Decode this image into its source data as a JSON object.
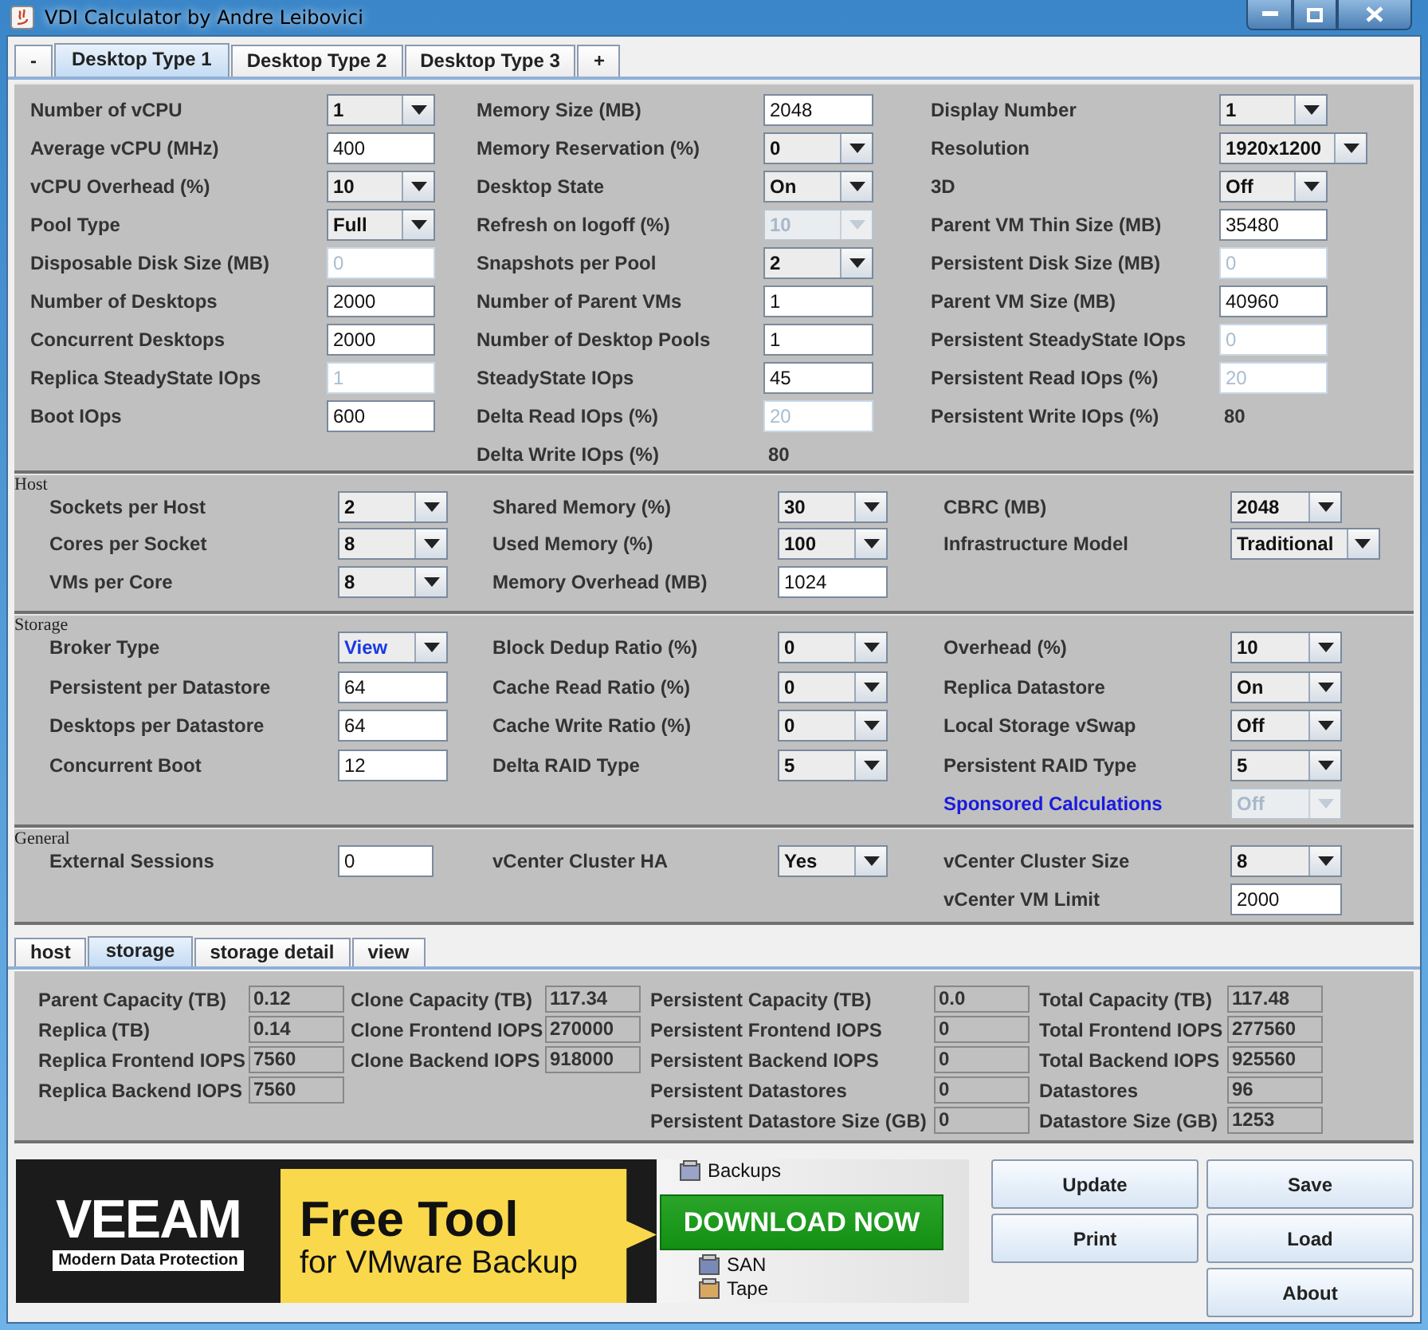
{
  "window": {
    "title": "VDI Calculator by Andre Leibovici"
  },
  "desktop_tabs": [
    {
      "label": "-",
      "selected": false
    },
    {
      "label": "Desktop Type 1",
      "selected": true
    },
    {
      "label": "Desktop Type 2",
      "selected": false
    },
    {
      "label": "Desktop Type 3",
      "selected": false
    },
    {
      "label": "+",
      "selected": false
    }
  ],
  "sections": [
    {
      "columns": [
        [
          {
            "label": "Number of vCPU",
            "kind": "combo",
            "value": "1",
            "disabled": false
          },
          {
            "label": "Average vCPU (MHz)",
            "kind": "text",
            "value": "400",
            "disabled": false
          },
          {
            "label": "vCPU Overhead (%)",
            "kind": "combo",
            "value": "10",
            "disabled": false
          },
          {
            "label": "Pool Type",
            "kind": "combo",
            "value": "Full",
            "disabled": false
          },
          {
            "label": "Disposable Disk Size (MB)",
            "kind": "text",
            "value": "0",
            "disabled": true
          },
          {
            "label": "Number of Desktops",
            "kind": "text",
            "value": "2000",
            "disabled": false
          },
          {
            "label": "Concurrent Desktops",
            "kind": "text",
            "value": "2000",
            "disabled": false
          },
          {
            "label": "Replica SteadyState IOps",
            "kind": "text",
            "value": "1",
            "disabled": true
          },
          {
            "label": "Boot IOps",
            "kind": "text",
            "value": "600",
            "disabled": false
          }
        ],
        [
          {
            "label": "Memory Size (MB)",
            "kind": "text",
            "value": "2048",
            "disabled": false
          },
          {
            "label": "Memory Reservation (%)",
            "kind": "combo",
            "value": "0",
            "disabled": false
          },
          {
            "label": "Desktop State",
            "kind": "combo",
            "value": "On",
            "disabled": false
          },
          {
            "label": "Refresh on logoff (%)",
            "kind": "combo",
            "value": "10",
            "disabled": true
          },
          {
            "label": "Snapshots per Pool",
            "kind": "combo",
            "value": "2",
            "disabled": false
          },
          {
            "label": "Number of Parent VMs",
            "kind": "text",
            "value": "1",
            "disabled": false
          },
          {
            "label": "Number of Desktop Pools",
            "kind": "text",
            "value": "1",
            "disabled": false
          },
          {
            "label": "SteadyState IOps",
            "kind": "text",
            "value": "45",
            "disabled": false
          },
          {
            "label": "Delta Read IOps (%)",
            "kind": "text",
            "value": "20",
            "disabled": true
          },
          {
            "label": "Delta Write IOps (%)",
            "kind": "value",
            "value": "80"
          }
        ],
        [
          {
            "label": "Display Number",
            "kind": "combo",
            "value": "1",
            "disabled": false
          },
          {
            "label": "Resolution",
            "kind": "combo",
            "value": "1920x1200",
            "disabled": false
          },
          {
            "label": "3D",
            "kind": "combo",
            "value": "Off",
            "disabled": false
          },
          {
            "label": "Parent VM Thin Size (MB)",
            "kind": "text",
            "value": "35480",
            "disabled": false
          },
          {
            "label": "Persistent Disk Size (MB)",
            "kind": "text",
            "value": "0",
            "disabled": true
          },
          {
            "label": "Parent VM Size (MB)",
            "kind": "text",
            "value": "40960",
            "disabled": false
          },
          {
            "label": "Persistent SteadyState IOps",
            "kind": "text",
            "value": "0",
            "disabled": true
          },
          {
            "label": "Persistent Read IOps (%)",
            "kind": "text",
            "value": "20",
            "disabled": true
          },
          {
            "label": "Persistent Write IOps (%)",
            "kind": "value",
            "value": "80"
          }
        ]
      ]
    },
    {
      "title": "Host",
      "columns": [
        [
          {
            "label": "Sockets per Host",
            "kind": "combo",
            "value": "2",
            "disabled": false
          },
          {
            "label": "Cores per Socket",
            "kind": "combo",
            "value": "8",
            "disabled": false
          },
          {
            "label": "VMs per Core",
            "kind": "combo",
            "value": "8",
            "disabled": false
          }
        ],
        [
          {
            "label": "Shared Memory (%)",
            "kind": "combo",
            "value": "30",
            "disabled": false
          },
          {
            "label": "Used Memory (%)",
            "kind": "combo",
            "value": "100",
            "disabled": false
          },
          {
            "label": "Memory Overhead (MB)",
            "kind": "text",
            "value": "1024",
            "disabled": false
          }
        ],
        [
          {
            "label": "CBRC (MB)",
            "kind": "combo",
            "value": "2048",
            "disabled": false
          },
          {
            "label": "Infrastructure Model",
            "kind": "combo",
            "value": "Traditional",
            "disabled": false
          }
        ]
      ]
    },
    {
      "title": "Storage",
      "columns": [
        [
          {
            "label": "Broker Type",
            "kind": "combo",
            "value": "View",
            "disabled": false,
            "highlighted": true
          },
          {
            "label": "Persistent per Datastore",
            "kind": "text",
            "value": "64",
            "disabled": false
          },
          {
            "label": "Desktops per Datastore",
            "kind": "text",
            "value": "64",
            "disabled": false
          },
          {
            "label": "Concurrent Boot",
            "kind": "text",
            "value": "12",
            "disabled": false
          }
        ],
        [
          {
            "label": "Block Dedup Ratio (%)",
            "kind": "combo",
            "value": "0",
            "disabled": false
          },
          {
            "label": "Cache Read Ratio (%)",
            "kind": "combo",
            "value": "0",
            "disabled": false
          },
          {
            "label": "Cache Write Ratio (%)",
            "kind": "combo",
            "value": "0",
            "disabled": false
          },
          {
            "label": "Delta RAID Type",
            "kind": "combo",
            "value": "5",
            "disabled": false
          }
        ],
        [
          {
            "label": "Overhead (%)",
            "kind": "combo",
            "value": "10",
            "disabled": false
          },
          {
            "label": "Replica Datastore",
            "kind": "combo",
            "value": "On",
            "disabled": false
          },
          {
            "label": "Local Storage vSwap",
            "kind": "combo",
            "value": "Off",
            "disabled": false
          },
          {
            "label": "Persistent RAID Type",
            "kind": "combo",
            "value": "5",
            "disabled": false
          },
          {
            "label": "Sponsored Calculations",
            "kind": "combo",
            "value": "Off",
            "disabled": true,
            "link": true
          }
        ]
      ]
    },
    {
      "title": "General",
      "columns": [
        [
          {
            "label": "External Sessions",
            "kind": "text",
            "value": "0",
            "disabled": false
          }
        ],
        [
          {
            "label": "vCenter Cluster HA",
            "kind": "combo",
            "value": "Yes",
            "disabled": false
          }
        ],
        [
          {
            "label": "vCenter Cluster Size",
            "kind": "combo",
            "value": "8",
            "disabled": false
          },
          {
            "label": "vCenter VM Limit",
            "kind": "text",
            "value": "2000",
            "disabled": false
          }
        ]
      ]
    }
  ],
  "result_tabs": [
    {
      "label": "host",
      "selected": false
    },
    {
      "label": "storage",
      "selected": true
    },
    {
      "label": "storage detail",
      "selected": false
    },
    {
      "label": "view",
      "selected": false
    }
  ],
  "results": [
    [
      {
        "label": "Parent Capacity (TB)",
        "value": "0.12"
      },
      {
        "label": "Replica (TB)",
        "value": "0.14"
      },
      {
        "label": "Replica Frontend IOPS",
        "value": "7560"
      },
      {
        "label": "Replica Backend IOPS",
        "value": "7560"
      }
    ],
    [
      {
        "label": "Clone Capacity (TB)",
        "value": "117.34"
      },
      {
        "label": "Clone Frontend IOPS",
        "value": "270000"
      },
      {
        "label": "Clone Backend IOPS",
        "value": "918000"
      }
    ],
    [
      {
        "label": "Persistent Capacity (TB)",
        "value": "0.0"
      },
      {
        "label": "Persistent Frontend IOPS",
        "value": "0"
      },
      {
        "label": "Persistent Backend IOPS",
        "value": "0"
      },
      {
        "label": "Persistent Datastores",
        "value": "0"
      },
      {
        "label": "Persistent Datastore Size (GB)",
        "value": "0"
      }
    ],
    [
      {
        "label": "Total Capacity (TB)",
        "value": "117.48"
      },
      {
        "label": "Total Frontend IOPS",
        "value": "277560"
      },
      {
        "label": "Total Backend IOPS",
        "value": "925560"
      },
      {
        "label": "Datastores",
        "value": "96"
      },
      {
        "label": "Datastore Size (GB)",
        "value": "1253"
      }
    ]
  ],
  "banner": {
    "brand": "VEEAM",
    "tagline": "Modern Data Protection",
    "headline": "Free Tool",
    "subline": "for VMware Backup",
    "cta": "DOWNLOAD NOW",
    "tree": [
      "Backups",
      "SAN",
      "Tape"
    ]
  },
  "buttons": [
    [
      "Update",
      "Print"
    ],
    [
      "Save",
      "Load",
      "About"
    ]
  ]
}
